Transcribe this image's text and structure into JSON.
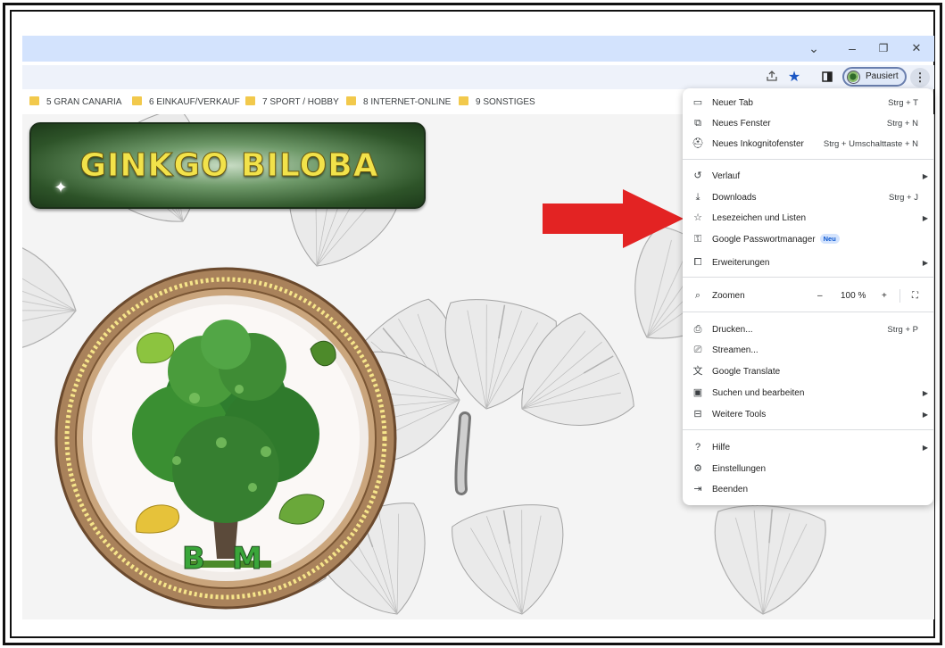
{
  "titlebar": {
    "chevron_icon": "chevron-down-icon",
    "min_label": "–",
    "restore_label": "❐",
    "close_label": "✕"
  },
  "toolbar": {
    "share_icon": "share-icon",
    "bookmark_star_icon": "star-filled-icon",
    "sidepanel_icon": "side-panel-icon",
    "profile_label": "Pausiert",
    "menu_label": "⋮"
  },
  "bookmarks": [
    {
      "label": "5 GRAN CANARIA"
    },
    {
      "label": "6 EINKAUF/VERKAUF"
    },
    {
      "label": "7 SPORT / HOBBY"
    },
    {
      "label": "8 INTERNET-ONLINE"
    },
    {
      "label": "9 SONSTIGES"
    }
  ],
  "page": {
    "banner_text": "GINKGO BILOBA",
    "logo_text": "BM",
    "colors": {
      "banner_gold": "#f2e24a",
      "arrow_red": "#e32323",
      "logo_green": "#3aa63a"
    }
  },
  "menu": {
    "items": [
      {
        "label": "Neuer Tab",
        "shortcut": "Strg + T",
        "icon": "new-tab-icon"
      },
      {
        "label": "Neues Fenster",
        "shortcut": "Strg + N",
        "icon": "new-window-icon"
      },
      {
        "label": "Neues Inkognitofenster",
        "shortcut": "Strg + Umschalttaste + N",
        "icon": "incognito-icon"
      },
      {
        "label": "Verlauf",
        "shortcut": "",
        "icon": "history-icon"
      },
      {
        "label": "Downloads",
        "shortcut": "Strg + J",
        "icon": "download-icon"
      },
      {
        "label": "Lesezeichen und Listen",
        "shortcut": "",
        "icon": "star-icon"
      },
      {
        "label": "Google Passwortmanager",
        "shortcut": "",
        "icon": "key-icon",
        "badge": "Neu"
      },
      {
        "label": "Erweiterungen",
        "shortcut": "",
        "icon": "puzzle-icon"
      },
      {
        "label": "Zoomen",
        "shortcut": "",
        "icon": "zoom-icon"
      },
      {
        "label": "Drucken...",
        "shortcut": "Strg + P",
        "icon": "print-icon"
      },
      {
        "label": "Streamen...",
        "shortcut": "",
        "icon": "cast-icon"
      },
      {
        "label": "Google Translate",
        "shortcut": "",
        "icon": "translate-icon"
      },
      {
        "label": "Suchen und bearbeiten",
        "shortcut": "",
        "icon": "find-icon"
      },
      {
        "label": "Weitere Tools",
        "shortcut": "",
        "icon": "toolbox-icon"
      },
      {
        "label": "Hilfe",
        "shortcut": "",
        "icon": "help-icon"
      },
      {
        "label": "Einstellungen",
        "shortcut": "",
        "icon": "settings-icon"
      },
      {
        "label": "Beenden",
        "shortcut": "",
        "icon": "exit-icon"
      }
    ],
    "zoom": {
      "minus": "–",
      "value": "100 %",
      "plus": "+",
      "fullscreen_icon": "fullscreen-icon"
    }
  }
}
